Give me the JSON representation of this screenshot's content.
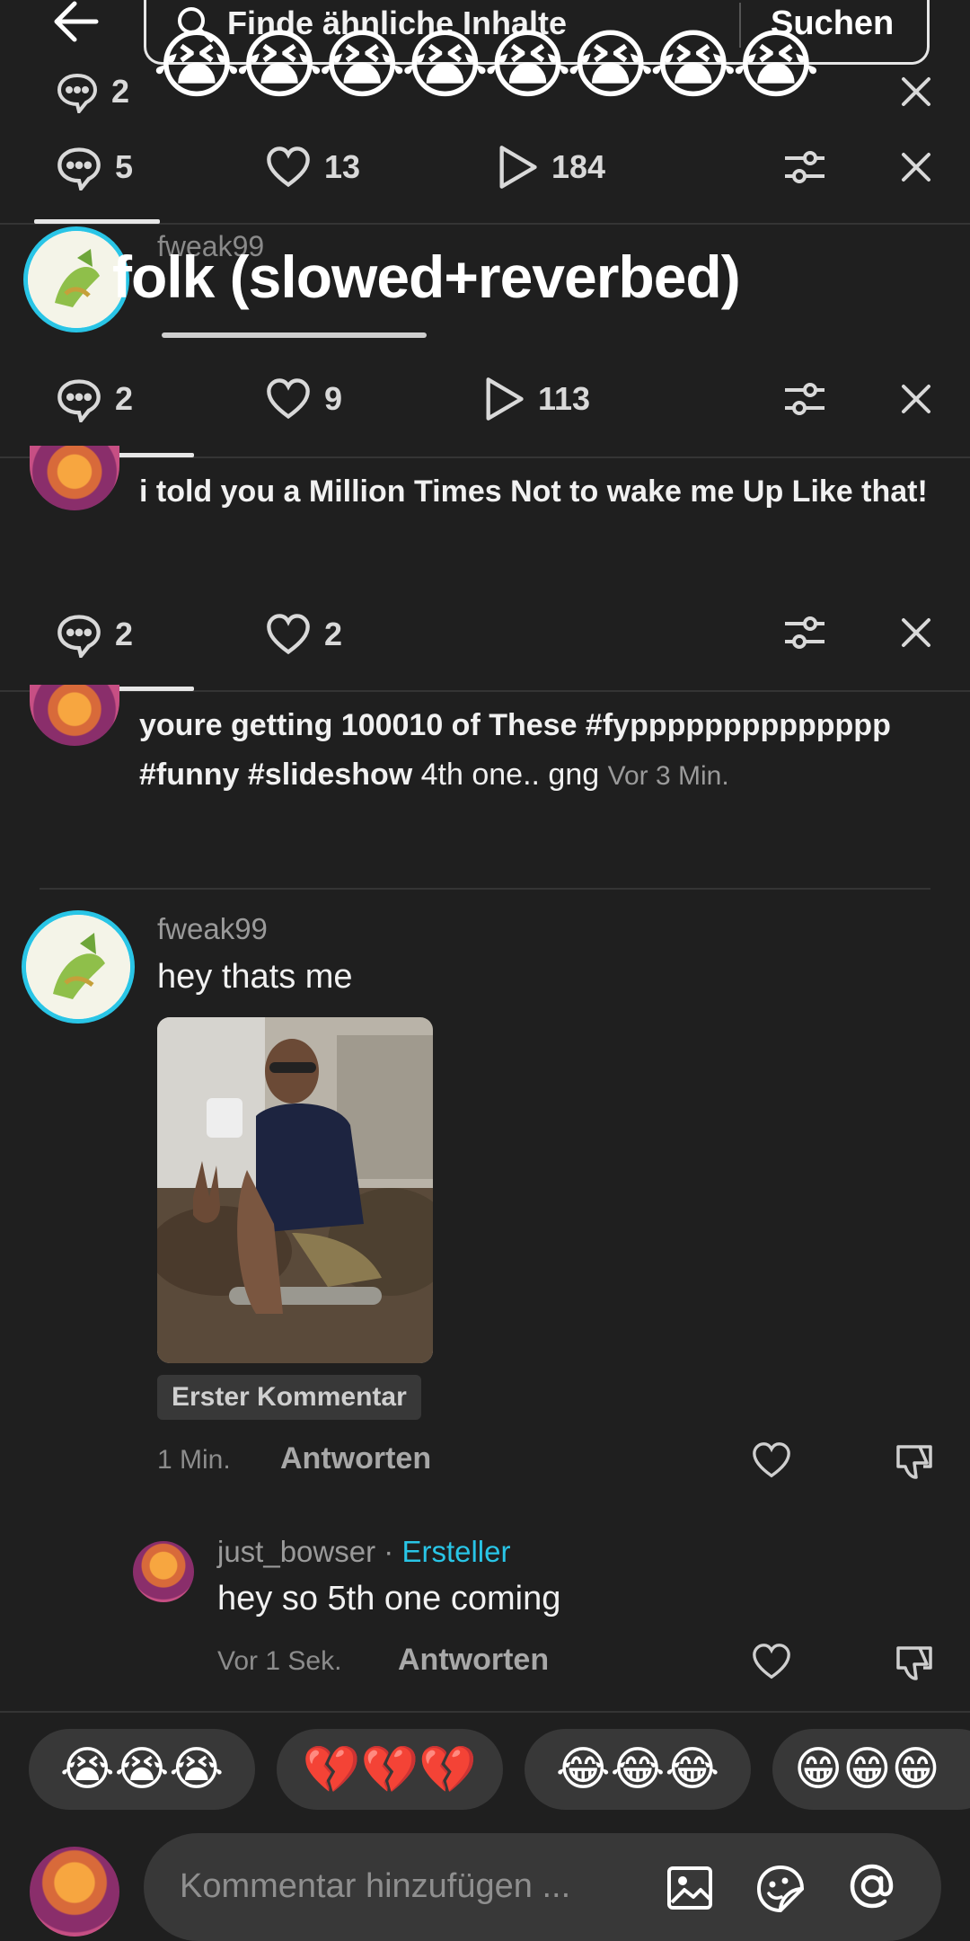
{
  "search": {
    "placeholder": "Finde ähnliche Inhalte",
    "button": "Suchen",
    "emoji_row": "😭😭😭😭😭😭😭😭"
  },
  "rows": [
    {
      "comments": "2"
    },
    {
      "comments": "5",
      "likes": "13",
      "plays": "184"
    },
    {
      "comments": "2",
      "likes": "9",
      "plays": "113"
    },
    {
      "comments": "2",
      "likes": "2"
    }
  ],
  "overlay": {
    "username": "fweak99",
    "title": "folk (slowed+reverbed)"
  },
  "post1": {
    "text": "i told you a Million Times Not to wake me Up Like that!"
  },
  "post2": {
    "text_bold": "youre getting 100010 of These #fypppppppppppppp #funny #slideshow",
    "text_plain": "4th one.. gng",
    "time": "Vor 3 Min."
  },
  "comment1": {
    "username": "fweak99",
    "text": "hey thats me",
    "badge": "Erster Kommentar",
    "time": "1 Min.",
    "reply": "Antworten"
  },
  "comment2": {
    "username": "just_bowser",
    "dot": "·",
    "role": "Ersteller",
    "text": "hey so 5th one coming",
    "time": "Vor 1 Sek.",
    "reply": "Antworten"
  },
  "reactions": [
    "😭😭😭",
    "💔💔💔",
    "😂😂😂",
    "😁😁😁"
  ],
  "composer": {
    "placeholder": "Kommentar hinzufügen ..."
  },
  "colors": {
    "accent": "#29c5e6",
    "background": "#1f1f1f"
  }
}
